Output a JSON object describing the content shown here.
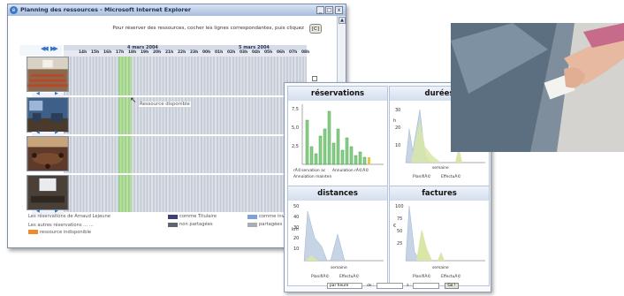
{
  "window": {
    "title": "Planning des ressources - Microsoft Internet Explorer"
  },
  "planning": {
    "instruction": "Pour réserver des ressources, cocher les lignes correspondantes, puis cliquez",
    "ok_label": "[C]",
    "nav_prev": "◀◀",
    "nav_next": "▶▶",
    "dates": [
      "4 mars 2004",
      "5 mars 2004"
    ],
    "hours": [
      "14h",
      "15h",
      "16h",
      "17h",
      "18h",
      "19h",
      "20h",
      "21h",
      "22h",
      "23h",
      "00h",
      "01h",
      "02h",
      "03h",
      "04h",
      "05h",
      "06h",
      "07h",
      "08h"
    ],
    "tooltip": "Ressource disponible"
  },
  "legend": {
    "left": [
      "Les réservations de Arnaud Lejeune",
      "Les autres réservations ... ...",
      "ressource indisponible"
    ],
    "right": [
      "comme Titulaire",
      "non partagées",
      "comme invité",
      "partagées"
    ],
    "colors": {
      "titulaire": "#3b3f7a",
      "non_partagees": "#5f646f",
      "invite": "#7da3d6",
      "partagees": "#a9adb5",
      "indisponible": "#f08a2c"
    }
  },
  "charts": {
    "reservations": {
      "title": "réservations",
      "legend": [
        "rÃ©servation ac",
        "Annulation rÃ©Ã©",
        "Annulation mainten"
      ],
      "y_ticks": [
        "7,5",
        "5,0",
        "2,5",
        "0"
      ]
    },
    "durees": {
      "title": "durées",
      "x_label": "semaine",
      "y_label": "h",
      "y_ticks": [
        "30",
        "20",
        "10",
        "0"
      ],
      "legend": [
        "PlanifiÃ©",
        "EffectuÃ©"
      ]
    },
    "distances": {
      "title": "distances",
      "x_label": "semaine",
      "y_label": "km",
      "y_ticks": [
        "50",
        "40",
        "30",
        "20",
        "10",
        "0"
      ],
      "legend": [
        "PlanifiÃ©",
        "EffectuÃ©"
      ]
    },
    "factures": {
      "title": "factures",
      "x_label": "semaine",
      "y_label": "€",
      "y_ticks": [
        "100",
        "75",
        "50",
        "25",
        "0"
      ],
      "legend": [
        "PlanifiÃ©",
        "EffectuÃ©"
      ]
    },
    "footer": {
      "select_value": "par heure",
      "de_label": "de :",
      "a_label": "à :",
      "ok_label": "Go !"
    }
  }
}
